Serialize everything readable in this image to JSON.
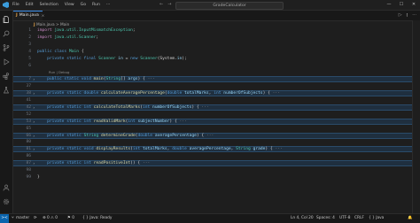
{
  "titlebar": {
    "menu": [
      "File",
      "Edit",
      "Selection",
      "View",
      "Go",
      "Run"
    ],
    "more": "···",
    "search": "GradeCalculator",
    "nav_back": "←",
    "nav_forward": "→",
    "window_controls": [
      "—",
      "☐",
      "✕"
    ]
  },
  "activitybar": {
    "icons": [
      "files-icon",
      "search-icon",
      "source-control-icon",
      "run-debug-icon",
      "extensions-icon",
      "test-icon",
      "accounts-icon",
      "settings-gear-icon"
    ]
  },
  "tab": {
    "icon": "J",
    "label": "Main.java",
    "close": "×"
  },
  "tab_actions": [
    "▷",
    "⫾",
    "···"
  ],
  "breadcrumb": {
    "parts": [
      "J",
      "Main.java",
      ">",
      "Main"
    ]
  },
  "editor": {
    "codelens": "Run | Debug",
    "lines": [
      {
        "n": "1",
        "tokens": [
          [
            "kw2",
            "import "
          ],
          [
            "ty",
            "java.util.InputMismatchException"
          ],
          [
            "",
            "; "
          ]
        ]
      },
      {
        "n": "2",
        "tokens": [
          [
            "kw2",
            "import "
          ],
          [
            "ty",
            "java.util.Scanner"
          ],
          [
            "",
            "; "
          ]
        ]
      },
      {
        "n": "3",
        "tokens": []
      },
      {
        "n": "4",
        "tokens": [
          [
            "kw",
            "public class "
          ],
          [
            "ty",
            "Main "
          ],
          [
            "",
            "{"
          ]
        ]
      },
      {
        "n": "5",
        "tokens": [
          [
            "kw",
            "    private static final "
          ],
          [
            "ty",
            "Scanner "
          ],
          [
            "var",
            "in "
          ],
          [
            "",
            "= "
          ],
          [
            "kw",
            "new "
          ],
          [
            "ty",
            "Scanner"
          ],
          [
            "",
            "(System."
          ],
          [
            "var",
            "in"
          ],
          [
            "",
            ");"
          ]
        ]
      },
      {
        "n": "6",
        "tokens": []
      },
      {
        "n": "7",
        "fold": true,
        "tokens": [
          [
            "kw",
            "    public static void "
          ],
          [
            "fn",
            "main"
          ],
          [
            "",
            "("
          ],
          [
            "ty",
            "String"
          ],
          [
            "",
            "[] "
          ],
          [
            "var",
            "args"
          ],
          [
            "",
            ") { "
          ],
          [
            "ell",
            "···"
          ]
        ]
      },
      {
        "n": "37",
        "tokens": []
      },
      {
        "n": "38",
        "fold": true,
        "tokens": [
          [
            "kw",
            "    private static double "
          ],
          [
            "fn",
            "calculateAveragePercentage"
          ],
          [
            "",
            "("
          ],
          [
            "kw",
            "double "
          ],
          [
            "var",
            "totalMarks"
          ],
          [
            "",
            ", "
          ],
          [
            "kw",
            "int "
          ],
          [
            "var",
            "numberOfSubjects"
          ],
          [
            "",
            ") { "
          ],
          [
            "ell",
            "···"
          ]
        ]
      },
      {
        "n": "41",
        "tokens": []
      },
      {
        "n": "42",
        "fold": true,
        "tokens": [
          [
            "kw",
            "    private static int "
          ],
          [
            "fn",
            "calculateTotalMarks"
          ],
          [
            "",
            "("
          ],
          [
            "kw",
            "int "
          ],
          [
            "var",
            "numberOfSubjects"
          ],
          [
            "",
            ") { "
          ],
          [
            "ell",
            "···"
          ]
        ]
      },
      {
        "n": "52",
        "tokens": []
      },
      {
        "n": "53",
        "fold": true,
        "tokens": [
          [
            "kw",
            "    private static int "
          ],
          [
            "fn",
            "readValidMark"
          ],
          [
            "",
            "("
          ],
          [
            "kw",
            "int "
          ],
          [
            "var",
            "subjectNumber"
          ],
          [
            "",
            ") { "
          ],
          [
            "ell",
            "···"
          ]
        ]
      },
      {
        "n": "65",
        "tokens": []
      },
      {
        "n": "66",
        "fold": true,
        "tokens": [
          [
            "kw",
            "    private static "
          ],
          [
            "ty",
            "String "
          ],
          [
            "fn",
            "determineGrade"
          ],
          [
            "",
            "("
          ],
          [
            "kw",
            "double "
          ],
          [
            "var",
            "averagePercentage"
          ],
          [
            "",
            ") { "
          ],
          [
            "ell",
            "···"
          ]
        ]
      },
      {
        "n": "80",
        "tokens": []
      },
      {
        "n": "81",
        "fold": true,
        "tokens": [
          [
            "kw",
            "    private static void "
          ],
          [
            "fn",
            "displayResults"
          ],
          [
            "",
            "("
          ],
          [
            "kw",
            "int "
          ],
          [
            "var",
            "totalMarks"
          ],
          [
            "",
            ", "
          ],
          [
            "kw",
            "double "
          ],
          [
            "var",
            "averagePercentage"
          ],
          [
            "",
            ", "
          ],
          [
            "ty",
            "String "
          ],
          [
            "var",
            "grade"
          ],
          [
            "",
            ") { "
          ],
          [
            "ell",
            "···"
          ]
        ]
      },
      {
        "n": "86",
        "tokens": []
      },
      {
        "n": "87",
        "fold": true,
        "tokens": [
          [
            "kw",
            "    private static int "
          ],
          [
            "fn",
            "readPositiveInt"
          ],
          [
            "",
            "() { "
          ],
          [
            "ell",
            "···"
          ]
        ]
      },
      {
        "n": "98",
        "tokens": []
      },
      {
        "n": "99",
        "tokens": [
          [
            "",
            "}"
          ]
        ]
      }
    ]
  },
  "statusbar": {
    "remote": "><",
    "branch": "master",
    "sync": "⟳",
    "problems": "⊗ 0  ⚠ 0",
    "ports": "⚑ 0",
    "java": "{ } Java: Ready",
    "right": [
      "Ln 4, Col 20",
      "Spaces: 4",
      "UTF-8",
      "CRLF",
      "{ } Java",
      "🔔"
    ]
  }
}
